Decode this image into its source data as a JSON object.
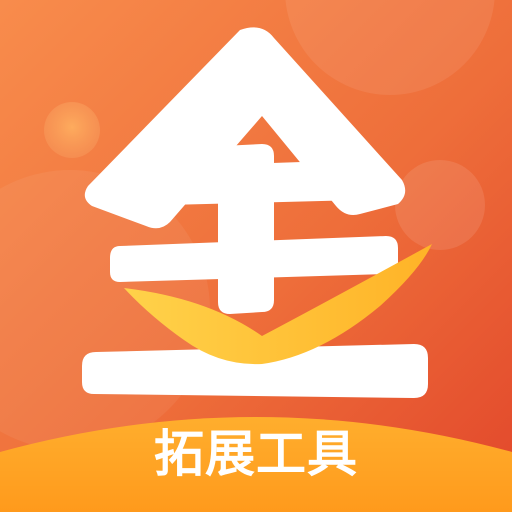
{
  "caption": "拓展工具",
  "logo": {
    "glyph_name": "quan-character-logo",
    "colors": {
      "background_top": "#F6894B",
      "background_bottom": "#E44E2E",
      "glyph": "#FFFFFF",
      "accent_swoosh": "#FFC33A",
      "bottom_band": "#FFA323",
      "caption_text": "#FFFFFF"
    }
  }
}
